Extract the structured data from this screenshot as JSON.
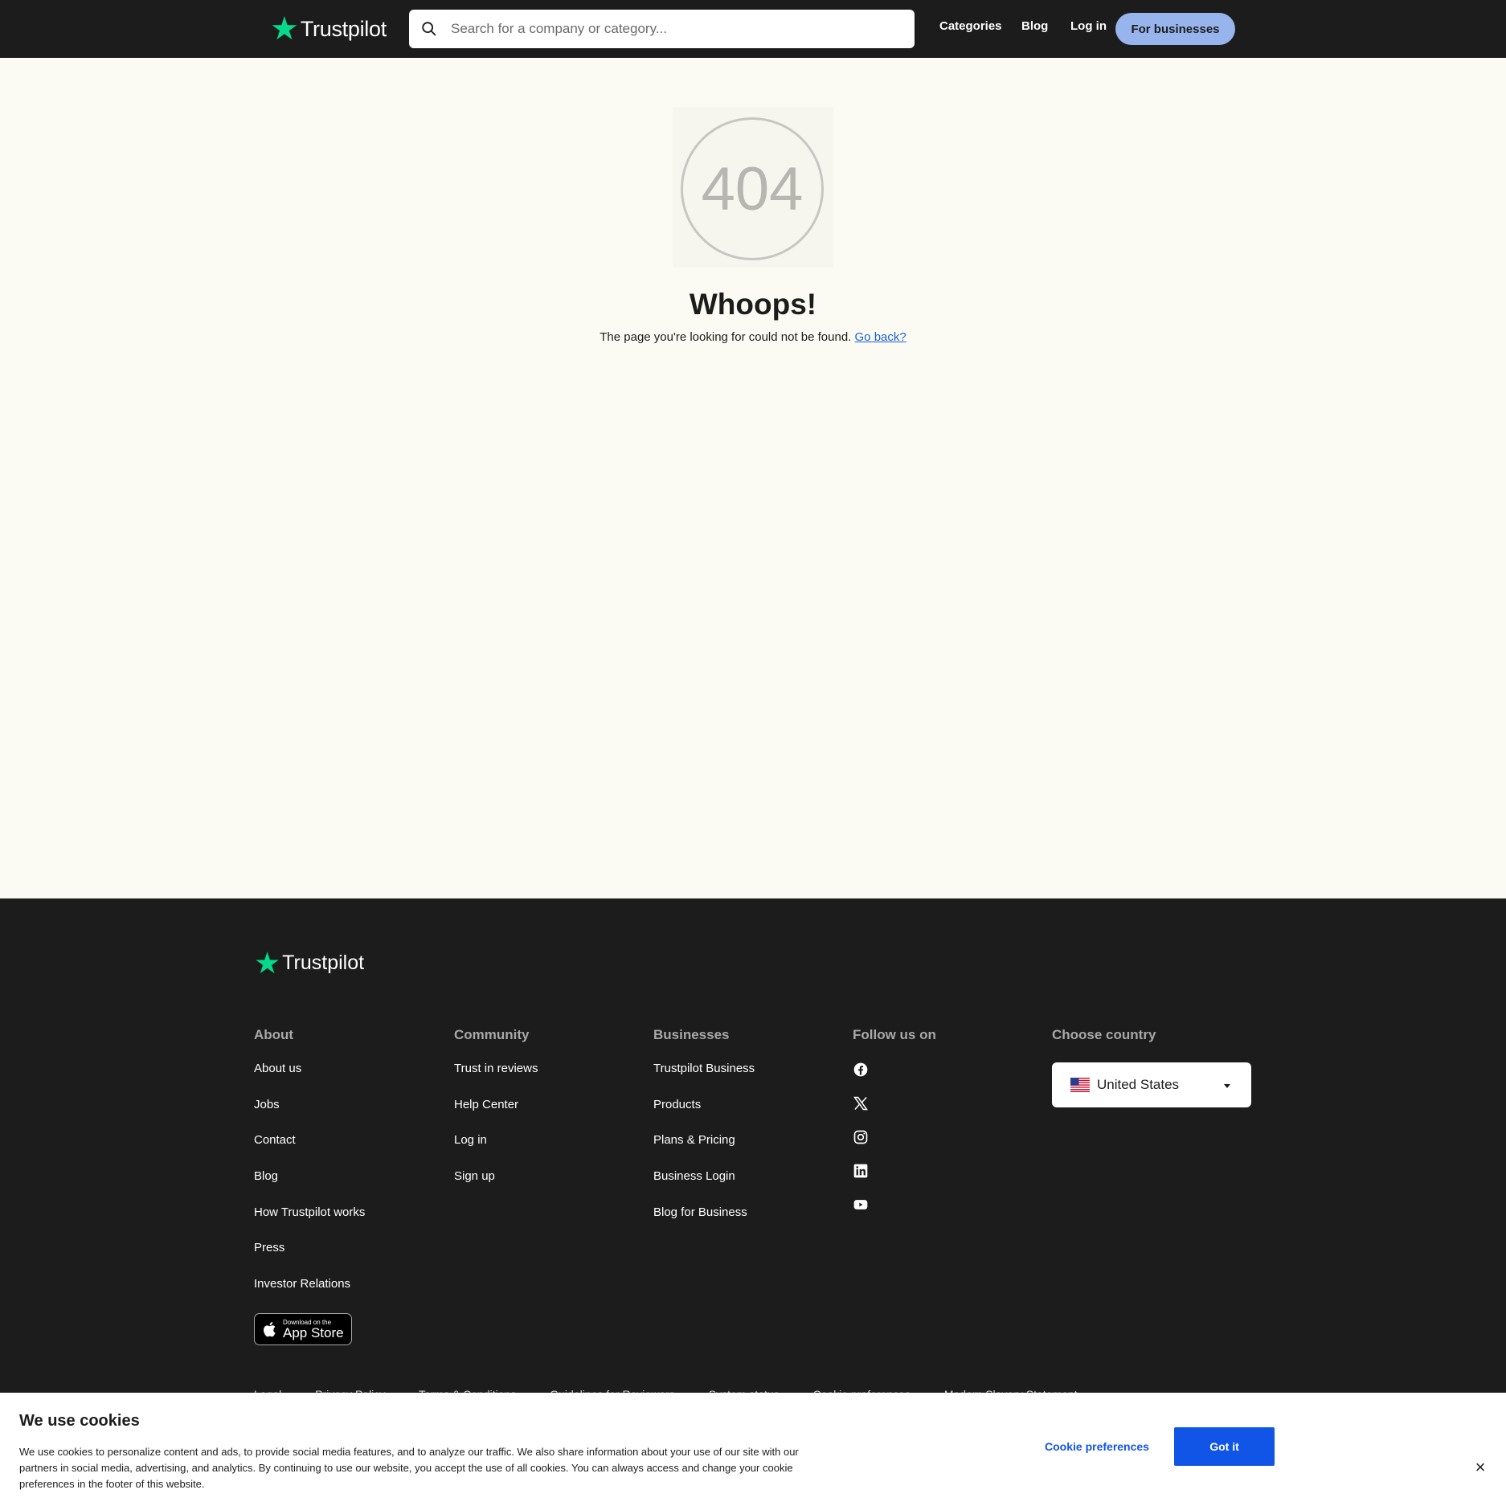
{
  "header": {
    "logo_text": "Trustpilot",
    "search_placeholder": "Search for a company or category...",
    "nav": [
      "Categories",
      "Blog",
      "Log in"
    ],
    "for_businesses": "For businesses"
  },
  "error": {
    "code": "404",
    "title": "Whoops!",
    "message": "The page you're looking for could not be found.",
    "link": "Go back?"
  },
  "footer": {
    "logo_text": "Trustpilot",
    "columns": [
      {
        "heading": "About",
        "links": [
          "About us",
          "Jobs",
          "Contact",
          "Blog",
          "How Trustpilot works",
          "Press",
          "Investor Relations"
        ]
      },
      {
        "heading": "Community",
        "links": [
          "Trust in reviews",
          "Help Center",
          "Log in",
          "Sign up"
        ]
      },
      {
        "heading": "Businesses",
        "links": [
          "Trustpilot Business",
          "Products",
          "Plans & Pricing",
          "Business Login",
          "Blog for Business"
        ]
      }
    ],
    "follow_heading": "Follow us on",
    "social_icons": [
      "facebook-icon",
      "x-icon",
      "instagram-icon",
      "linkedin-icon",
      "youtube-icon"
    ],
    "country_heading": "Choose country",
    "country_selected": "United States",
    "appstore": {
      "small": "Download on the",
      "big": "App Store"
    },
    "legal_partial": [
      "Legal",
      "Privacy Policy",
      "Terms & Conditions",
      "Guidelines for Reviewers",
      "System status",
      "Cookie preferences",
      "Modern Slavery Statement"
    ]
  },
  "cookie": {
    "title": "We use cookies",
    "text": "We use cookies to personalize content and ads, to provide social media features, and to analyze our traffic. We also share information about your use of our site with our partners in social media, advertising, and analytics. By continuing to use our website, you accept the use of all cookies. You can always access and change your cookie preferences in the footer of this website.",
    "preferences_label": "Cookie preferences",
    "accept_label": "Got it",
    "close_glyph": "×"
  },
  "colors": {
    "brand_green": "#04da8d",
    "dark": "#1c1c1c",
    "page_bg": "#fcfbf3",
    "business_button": "#98b4ec",
    "primary_blue": "#1155e6"
  }
}
